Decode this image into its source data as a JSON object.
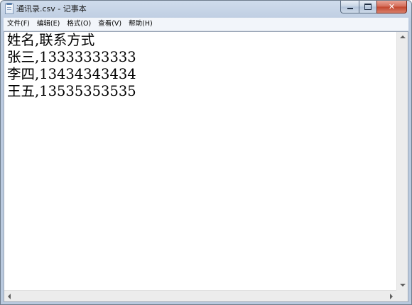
{
  "window": {
    "title": "通讯录.csv - 记事本",
    "icon": "notepad-icon",
    "minimize_label": "",
    "maximize_label": "",
    "close_label": "✕"
  },
  "menu": {
    "items": [
      {
        "label": "文件(F)"
      },
      {
        "label": "编辑(E)"
      },
      {
        "label": "格式(O)"
      },
      {
        "label": "查看(V)"
      },
      {
        "label": "帮助(H)"
      }
    ]
  },
  "document": {
    "lines": [
      "姓名,联系方式",
      "张三,13333333333",
      "李四,13434343434",
      "王五,13535353535"
    ]
  },
  "colors": {
    "titlebar": "#bccbe0",
    "close_button": "#c2452c",
    "editor_background": "#ffffff"
  }
}
